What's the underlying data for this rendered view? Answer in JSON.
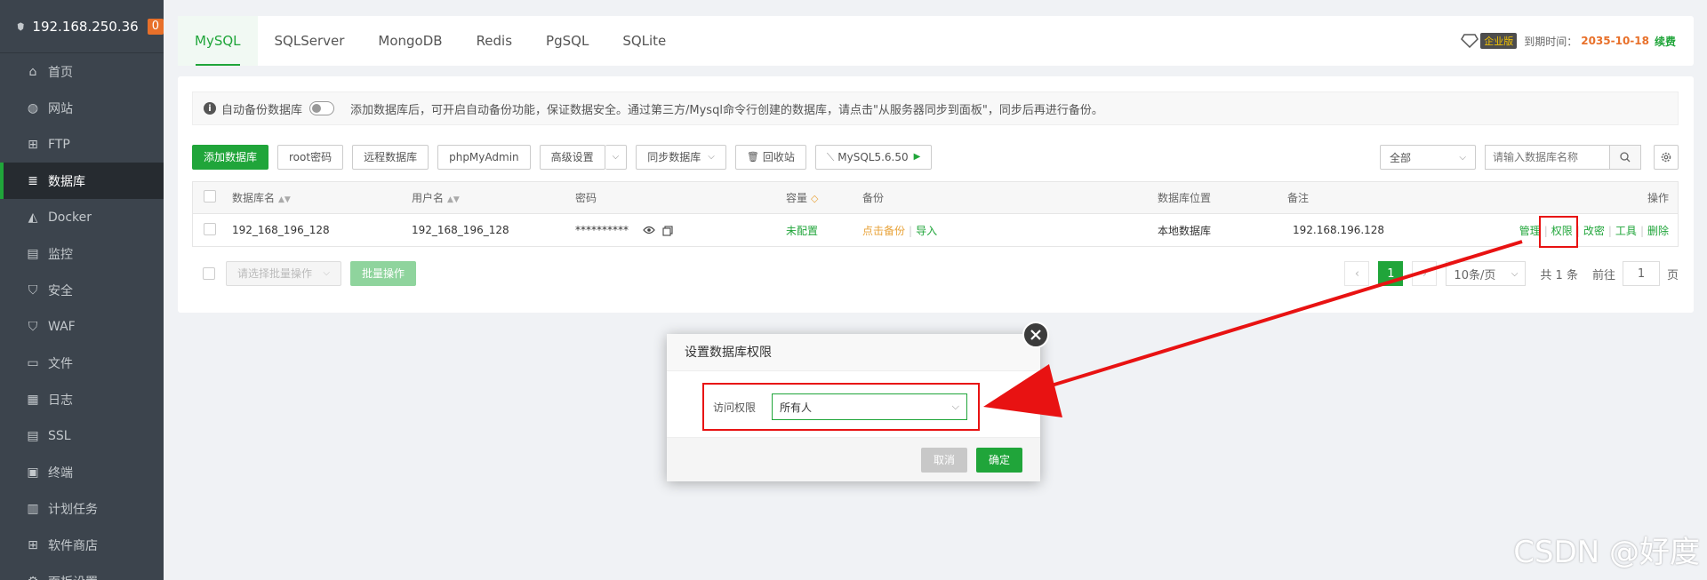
{
  "sidebar": {
    "host": "192.168.250.36",
    "badge": "0",
    "items": [
      {
        "label": "首页",
        "icon": "home-icon"
      },
      {
        "label": "网站",
        "icon": "globe-icon"
      },
      {
        "label": "FTP",
        "icon": "ftp-icon"
      },
      {
        "label": "数据库",
        "icon": "database-icon",
        "active": true
      },
      {
        "label": "Docker",
        "icon": "docker-icon"
      },
      {
        "label": "监控",
        "icon": "monitor-icon"
      },
      {
        "label": "安全",
        "icon": "shield-icon"
      },
      {
        "label": "WAF",
        "icon": "waf-shield-icon"
      },
      {
        "label": "文件",
        "icon": "folder-icon"
      },
      {
        "label": "日志",
        "icon": "log-icon"
      },
      {
        "label": "SSL",
        "icon": "ssl-icon"
      },
      {
        "label": "终端",
        "icon": "terminal-icon"
      },
      {
        "label": "计划任务",
        "icon": "calendar-icon"
      },
      {
        "label": "软件商店",
        "icon": "store-icon"
      },
      {
        "label": "面板设置",
        "icon": "settings-icon"
      }
    ]
  },
  "tabs": [
    "MySQL",
    "SQLServer",
    "MongoDB",
    "Redis",
    "PgSQL",
    "SQLite"
  ],
  "expire": {
    "edition": "企业版",
    "label": "到期时间：",
    "date": "2035-10-18",
    "renew": "续费"
  },
  "notice": {
    "toggle_label": "自动备份数据库",
    "text": "添加数据库后，可开启自动备份功能，保证数据安全。通过第三方/Mysql命令行创建的数据库，请点击\"从服务器同步到面板\"，同步后再进行备份。"
  },
  "toolbar": {
    "add": "添加数据库",
    "root_pwd": "root密码",
    "remote": "远程数据库",
    "phpmyadmin": "phpMyAdmin",
    "advanced": "高级设置",
    "sync": "同步数据库",
    "recycle": "回收站",
    "version": "MySQL5.6.50",
    "filter": "全部",
    "search_placeholder": "请输入数据库名称"
  },
  "table": {
    "headers": {
      "name": "数据库名",
      "user": "用户名",
      "password": "密码",
      "capacity": "容量",
      "backup": "备份",
      "location": "数据库位置",
      "remark": "备注",
      "ops": "操作"
    },
    "rows": [
      {
        "name": "192_168_196_128",
        "user": "192_168_196_128",
        "password": "**********",
        "capacity": "未配置",
        "backup_click": "点击备份",
        "import": "导入",
        "location": "本地数据库",
        "remark": "192.168.196.128",
        "ops": {
          "manage": "管理",
          "perm": "权限",
          "change_pwd": "改密",
          "tools": "工具",
          "delete": "删除"
        }
      }
    ]
  },
  "bottom": {
    "batch_select": "请选择批量操作",
    "batch_btn": "批量操作",
    "page_current": "1",
    "page_size": "10条/页",
    "total": "共 1 条",
    "goto": "前往",
    "goto_value": "1",
    "page_unit": "页"
  },
  "dialog": {
    "title": "设置数据库权限",
    "label": "访问权限",
    "value": "所有人",
    "cancel": "取消",
    "ok": "确定"
  },
  "watermark": "CSDN @好度",
  "colors": {
    "accent": "#20a53a",
    "highlight": "#e81212",
    "sidebar": "#3c444d"
  }
}
